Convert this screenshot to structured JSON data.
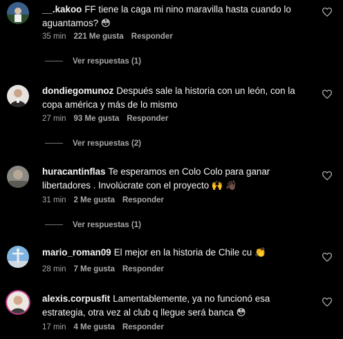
{
  "comments": [
    {
      "username": "__.kakoo",
      "text": "FF tiene la caga mi nino maravilla hasta cuando lo aguantamos?",
      "emoji": "😳",
      "time": "35 min",
      "likes": "221 Me gusta",
      "reply": "Responder",
      "replies": "Ver respuestas (1)"
    },
    {
      "username": "dondiegomunoz",
      "text": "Después sale la historia con un león, con la copa américa y más de lo mismo",
      "emoji": "",
      "time": "27 min",
      "likes": "93 Me gusta",
      "reply": "Responder",
      "replies": "Ver respuestas (2)"
    },
    {
      "username": "huracantinflas",
      "text": "Te esperamos en Colo Colo para ganar libertadores . Involúcrate con el proyecto",
      "emoji": "🙌 👋🏿",
      "time": "31 min",
      "likes": "2 Me gusta",
      "reply": "Responder",
      "replies": "Ver respuestas (1)"
    },
    {
      "username": "mario_roman09",
      "text": "El mejor en la historia de Chile cu",
      "emoji": "👏",
      "time": "28 min",
      "likes": "7 Me gusta",
      "reply": "Responder",
      "replies": ""
    },
    {
      "username": "alexis.corpusfit",
      "text": "Lamentablemente, ya no funcionó esa estrategia, otra vez al club q llegue será banca",
      "emoji": "😳",
      "time": "17 min",
      "likes": "4 Me gusta",
      "reply": "Responder",
      "replies": ""
    }
  ],
  "colors": {
    "background": "#000000",
    "text": "#f5f5f5",
    "secondary": "#a8a8a8",
    "divider": "#737373"
  }
}
